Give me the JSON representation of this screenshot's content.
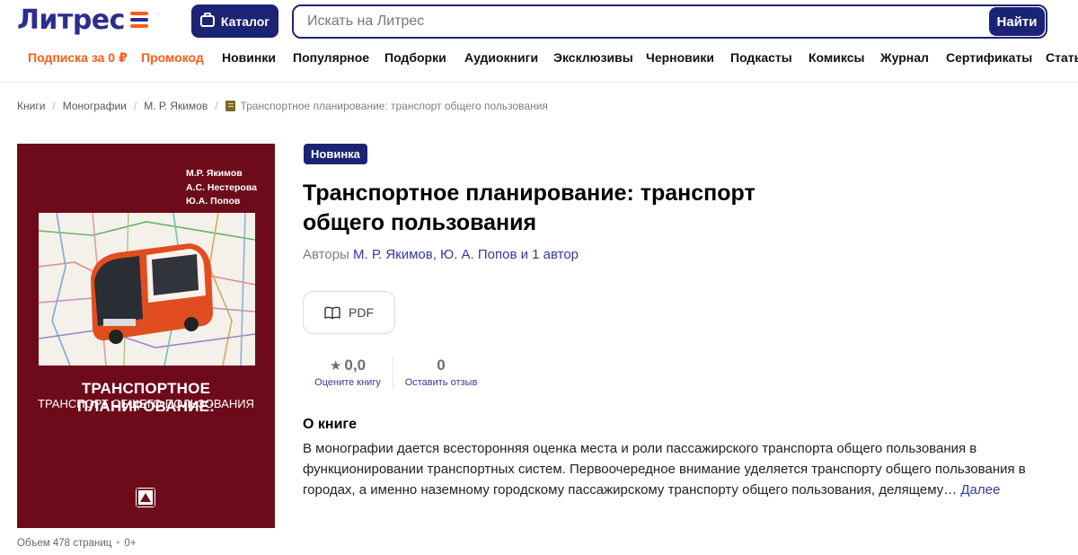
{
  "header": {
    "logo_text": "Литрес",
    "catalog_label": "Каталог",
    "search_placeholder": "Искать на Литрес",
    "search_button": "Найти",
    "colors": {
      "brand_blue": "#1b2374",
      "accent_orange": "#ff5c16"
    }
  },
  "nav": {
    "items": [
      {
        "label": "Подписка за 0 ₽",
        "accent": true
      },
      {
        "label": "Промокод",
        "accent": true
      },
      {
        "label": "Новинки"
      },
      {
        "label": "Популярное"
      },
      {
        "label": "Подборки"
      },
      {
        "label": "Аудиокниги"
      },
      {
        "label": "Эксклюзивы"
      },
      {
        "label": "Черновики"
      },
      {
        "label": "Подкасты"
      },
      {
        "label": "Комиксы"
      },
      {
        "label": "Журнал"
      },
      {
        "label": "Сертификаты"
      },
      {
        "label": "Стать"
      }
    ]
  },
  "breadcrumbs": {
    "items": [
      "Книги",
      "Монографии",
      "М. Р. Якимов"
    ],
    "current": "Транспортное планирование: транспорт общего пользования"
  },
  "cover": {
    "authors": [
      "М.Р. Якимов",
      "А.С. Нестерова",
      "Ю.А. Попов"
    ],
    "title_line1": "ТРАНСПОРТНОЕ ПЛАНИРОВАНИЕ:",
    "title_line2": "ТРАНСПОРТ ОБЩЕГО ПОЛЬЗОВАНИЯ"
  },
  "meta": {
    "volume": "Объем 478 страниц",
    "age": "0+"
  },
  "book": {
    "badge": "Новинка",
    "title": "Транспортное планирование: транспорт общего пользования",
    "authors_prefix": "Авторы",
    "authors_links": "М. Р. Якимов, Ю. А. Попов и 1 автор",
    "format": "PDF",
    "rating_value": "0,0",
    "rating_label": "Оцените книгу",
    "reviews_count": "0",
    "reviews_label": "Оставить отзыв",
    "about_heading": "О книге",
    "about_text": "В монографии дается всесторонняя оценка места и роли пассажирского транспорта общего пользования в функционировании транспортных систем. Первоочередное внимание уделяется транспорту общего пользования в городах, а именно наземному городскому пассажирскому транспорту общего пользования, делящему…",
    "more_label": "Далее"
  }
}
